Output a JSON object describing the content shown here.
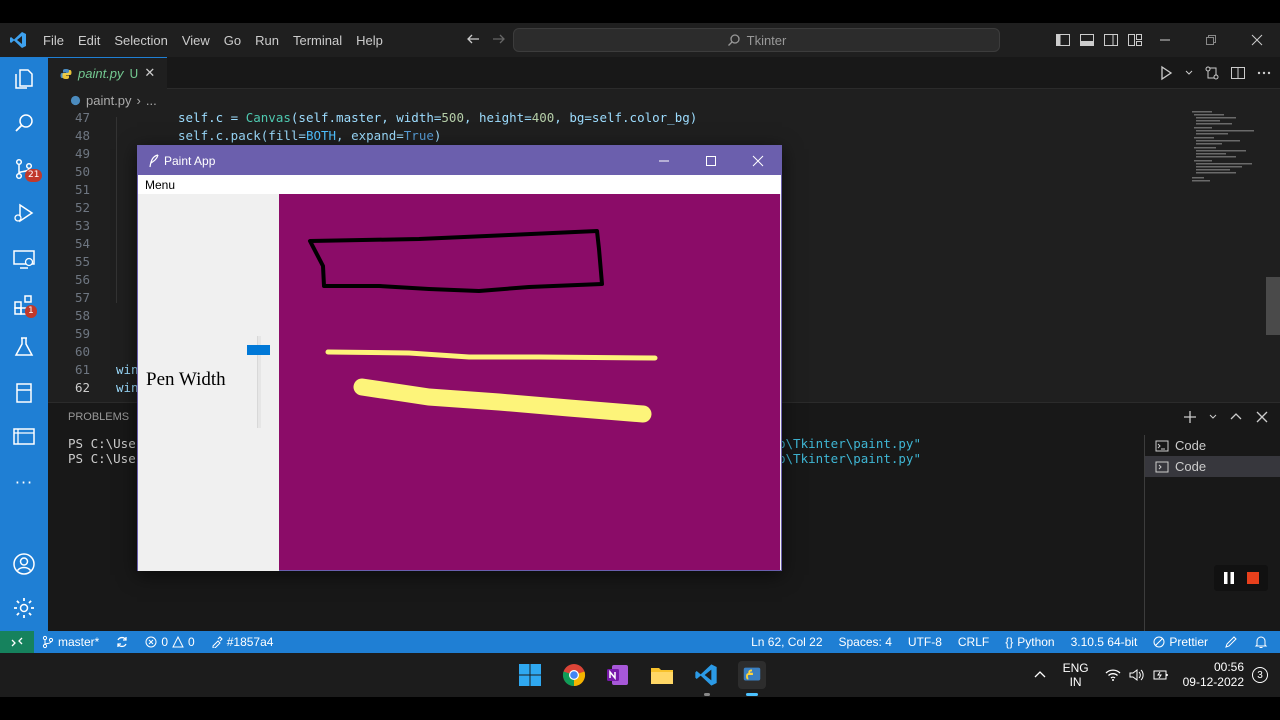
{
  "colors": {
    "accent": "#1f7fd4",
    "canvas_bg": "#8b0c68",
    "stroke_black": "#000000",
    "stroke_yellow": "#fdf47a"
  },
  "menu": [
    "File",
    "Edit",
    "Selection",
    "View",
    "Go",
    "Run",
    "Terminal",
    "Help"
  ],
  "command_center": {
    "text": "Tkinter"
  },
  "activity_bar": {
    "icons": [
      "explorer-icon",
      "search-icon",
      "source-control-icon",
      "run-debug-icon",
      "remote-explorer-icon",
      "extensions-icon",
      "testing-icon",
      "bookmark-icon",
      "panels-icon",
      "more-icon",
      "account-icon",
      "settings-icon"
    ],
    "scm_badge": "21",
    "ext_badge": "1",
    "more": "···"
  },
  "tab": {
    "name": "paint.py",
    "status": "U",
    "close": "✕"
  },
  "breadcrumb": {
    "file": "paint.py",
    "more": "..."
  },
  "code": {
    "lines": [
      "47",
      "48",
      "49",
      "50",
      "51",
      "52",
      "53",
      "54",
      "55",
      "56",
      "57",
      "58",
      "59",
      "60",
      "61",
      "62"
    ],
    "line47": {
      "a": "self.c = ",
      "b": "Canvas",
      "c": "(self.master, width=",
      "d": "500",
      "e": ", height=",
      "f": "400",
      "g": ", bg=self.color_bg)"
    },
    "line48": {
      "a": "self.c.pack(fill=",
      "b": "BOTH",
      "c": ", expand=",
      "d": "True",
      "e": ")"
    },
    "line61": "win",
    "line62": "win"
  },
  "panel": {
    "tab": "PROBLEMS",
    "term_left": [
      "PS C:\\User",
      "PS C:\\User"
    ],
    "term_right": [
      "p\\Tkinter\\paint.py\"",
      "p\\Tkinter\\paint.py\""
    ],
    "terminals": [
      "Code",
      "Code"
    ]
  },
  "status": {
    "branch": "master*",
    "errors": "0",
    "warnings": "0",
    "color": "#1857a4",
    "position": "Ln 62, Col 22",
    "spaces": "Spaces: 4",
    "encoding": "UTF-8",
    "eol": "CRLF",
    "language": "Python",
    "interpreter": "3.10.5 64-bit",
    "formatter": "Prettier"
  },
  "paint_app": {
    "title": "Paint App",
    "menu": "Menu",
    "pen_label": "Pen Width",
    "pen_width": 0.1
  },
  "tray": {
    "lang1": "ENG",
    "lang2": "IN",
    "time": "00:56",
    "date": "09-12-2022",
    "notif": "3"
  }
}
